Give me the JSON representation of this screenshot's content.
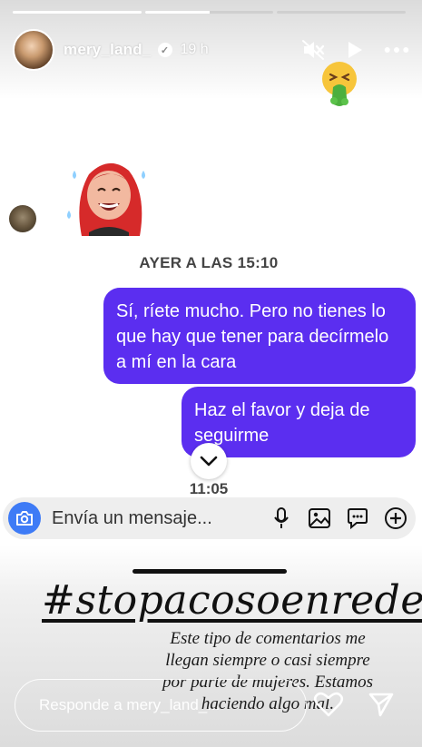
{
  "story": {
    "progress": [
      1.0,
      0.5,
      0.0
    ],
    "user": {
      "username": "mery_land_",
      "verified": true,
      "time_ago": "19 h"
    },
    "header_icons": [
      "mute-icon",
      "play-icon",
      "more-icon"
    ]
  },
  "conversation": {
    "ts_yesterday": "AYER A LAS 15:10",
    "messages": [
      {
        "text": "Sí, ríete mucho. Pero no tienes lo que hay que tener para decírmelo a mí en la cara",
        "sender": "me"
      },
      {
        "text": "Haz el favor y deja de seguirme",
        "sender": "me"
      }
    ],
    "ts_now": "11:05",
    "composer_placeholder": "Envía un mensaje...",
    "bubble_color": "#5b2ef0",
    "camera_color": "#3e7bf6"
  },
  "overlay": {
    "hashtag": "#stopacosoenredes",
    "caption_lines": [
      "Este tipo de comentarios me",
      "llegan siempre o casi siempre",
      "por parte de mujeres. Estamos",
      "haciendo algo mal."
    ]
  },
  "reply": {
    "placeholder": "Responde a mery_land_..."
  }
}
